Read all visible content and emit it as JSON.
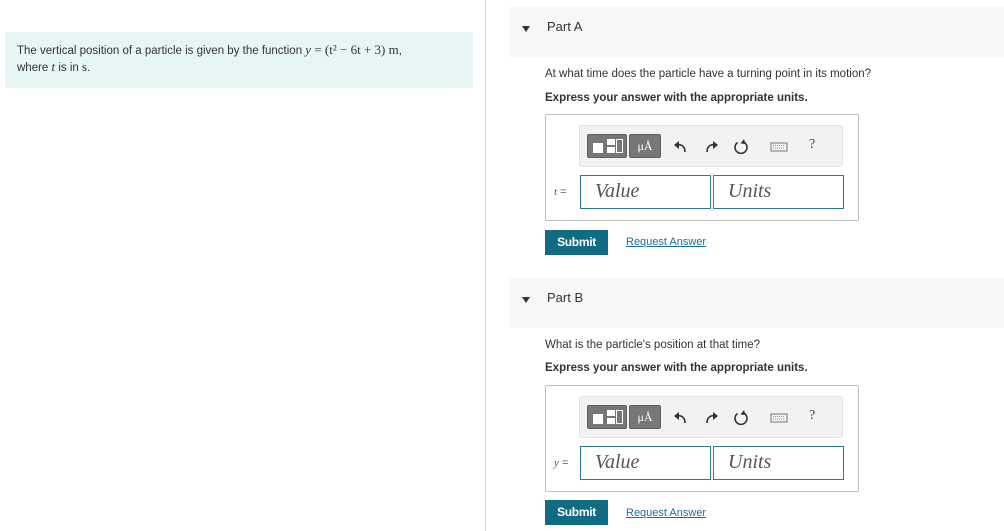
{
  "problem": {
    "text_before": "The vertical position of a particle is given by the function ",
    "equation_lhs": "y",
    "equation_eq": " = ",
    "equation_rhs": "(t² − 6t + 3)",
    "equation_unit": " m",
    "text_comma": ",",
    "text_line2_before": "where ",
    "var_t": "t",
    "text_line2_mid": " is in ",
    "unit_s": "s",
    "text_line2_end": "."
  },
  "part_a": {
    "title": "Part A",
    "question": "At what time does the particle have a turning point in its motion?",
    "instruction": "Express your answer with the appropriate units.",
    "variable": "t",
    "equals": " =",
    "value_placeholder": "Value",
    "units_placeholder": "Units",
    "submit_label": "Submit",
    "request_label": "Request Answer"
  },
  "part_b": {
    "title": "Part B",
    "question": "What is the particle's position at that time?",
    "instruction": "Express your answer with the appropriate units.",
    "variable": "y",
    "equals": " =",
    "value_placeholder": "Value",
    "units_placeholder": "Units",
    "submit_label": "Submit",
    "request_label": "Request Answer"
  },
  "toolbar": {
    "units_button_label": "μÅ",
    "help_label": "?",
    "icons": [
      "templates-icon",
      "units-icon",
      "undo-icon",
      "redo-icon",
      "reset-icon",
      "keyboard-icon",
      "help-icon"
    ]
  },
  "colors": {
    "problem_bg": "#e8f5f5",
    "accent": "#0f6c82",
    "link": "#1a6ea0",
    "field_border": "#2b7d8c"
  }
}
